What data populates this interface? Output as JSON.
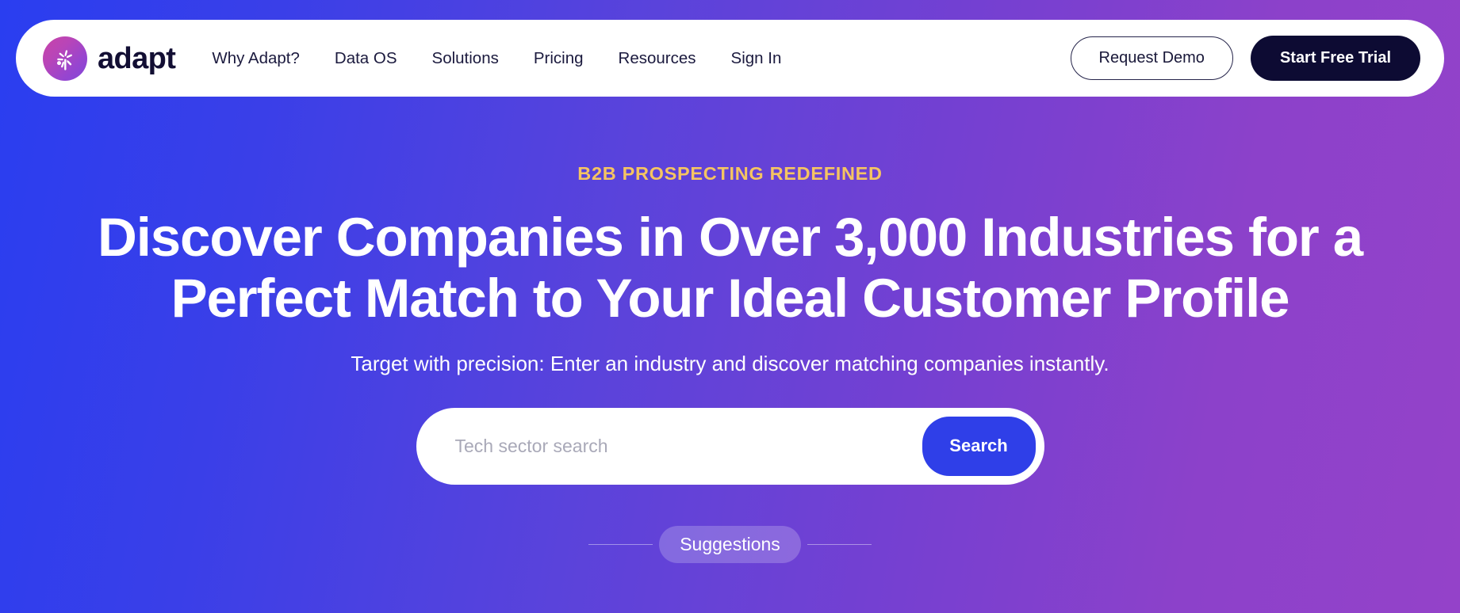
{
  "brand": {
    "name": "adapt",
    "logo_icon": "tree-logo-icon"
  },
  "nav": {
    "items": [
      {
        "label": "Why Adapt?",
        "key": "why-adapt"
      },
      {
        "label": "Data OS",
        "key": "data-os"
      },
      {
        "label": "Solutions",
        "key": "solutions"
      },
      {
        "label": "Pricing",
        "key": "pricing"
      },
      {
        "label": "Resources",
        "key": "resources"
      },
      {
        "label": "Sign In",
        "key": "sign-in"
      }
    ]
  },
  "header_actions": {
    "request_demo_label": "Request Demo",
    "start_trial_label": "Start Free Trial"
  },
  "hero": {
    "eyebrow": "B2B PROSPECTING REDEFINED",
    "headline": "Discover Companies in Over 3,000 Industries for a Perfect Match to Your Ideal Customer Profile",
    "subhead": "Target with precision: Enter an industry and discover matching companies instantly.",
    "industry_count": "3,000"
  },
  "search": {
    "placeholder": "Tech sector search",
    "value": "",
    "button_label": "Search"
  },
  "suggestions": {
    "label": "Suggestions"
  },
  "colors": {
    "gradient_start": "#2a3ef0",
    "gradient_end": "#9442c9",
    "eyebrow_gold": "#f5c462",
    "search_button_blue": "#2f3fe8",
    "dark_navy": "#0d0b33"
  }
}
